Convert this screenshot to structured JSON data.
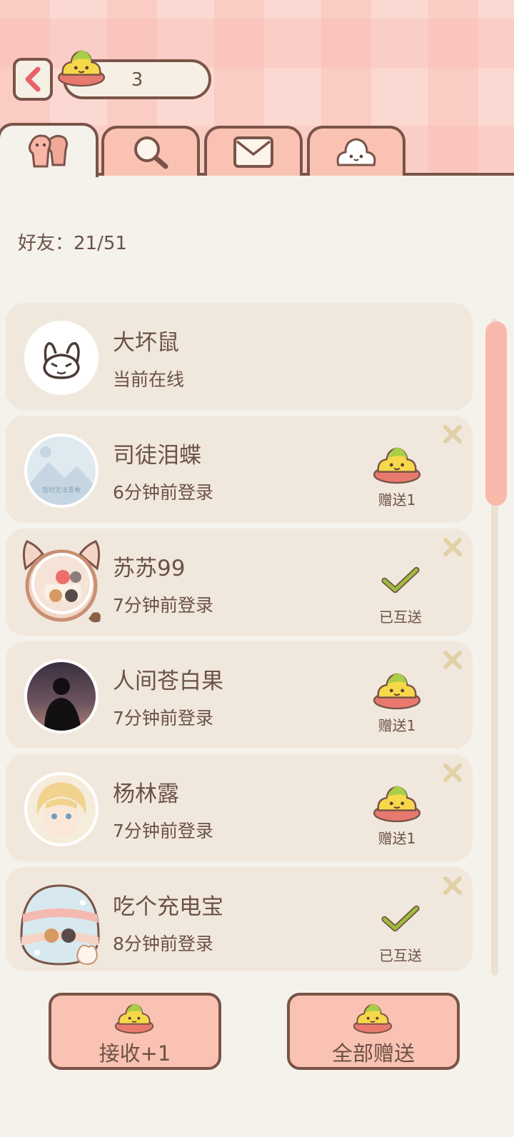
{
  "header": {
    "currency_count": "3"
  },
  "tabs": [
    {
      "name": "friends",
      "icon": "friends-icon"
    },
    {
      "name": "search",
      "icon": "search-icon"
    },
    {
      "name": "messages",
      "icon": "mail-icon"
    },
    {
      "name": "gifts",
      "icon": "mochi-icon"
    }
  ],
  "friend_count_label": "好友：21/51",
  "friends": [
    {
      "name": "大坏鼠",
      "status": "当前在线",
      "action": "",
      "avatar_color": "#ffffff"
    },
    {
      "name": "司徒泪蝶",
      "status": "6分钟前登录",
      "action": "赠送1",
      "avatar_color": "#dfe9f0",
      "avatar_caption": "暂时无法查看"
    },
    {
      "name": "苏苏99",
      "status": "7分钟前登录",
      "action": "已互送",
      "avatar_color": "#f3d6c6"
    },
    {
      "name": "人间苍白果",
      "status": "7分钟前登录",
      "action": "赠送1",
      "avatar_color": "#5a4a55"
    },
    {
      "name": "杨林露",
      "status": "7分钟前登录",
      "action": "赠送1",
      "avatar_color": "#f2dfb8"
    },
    {
      "name": "吃个充电宝",
      "status": "8分钟前登录",
      "action": "已互送",
      "avatar_color": "#d7e9ee"
    }
  ],
  "buttons": {
    "receive": "接收+1",
    "send_all": "全部赠送"
  },
  "colors": {
    "accent": "#f9c2b2",
    "outline": "#7a5448",
    "card": "#f1e8dd",
    "background": "#f5f2ec",
    "check": "#9bc03a"
  }
}
